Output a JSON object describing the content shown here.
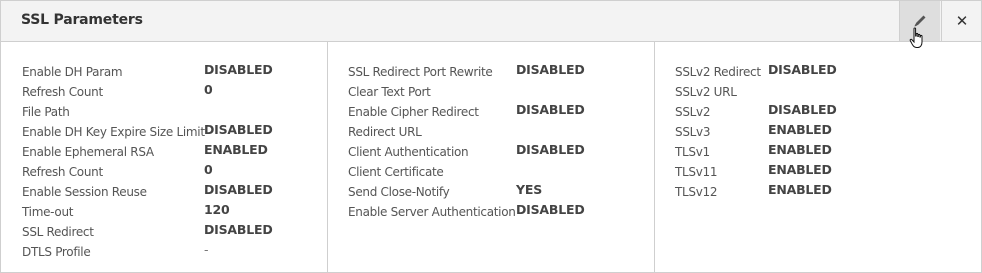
{
  "panel": {
    "title": "SSL Parameters",
    "edit_icon": "pencil-icon",
    "close_icon": "close-icon",
    "close_label": "✕"
  },
  "columns": [
    {
      "rows": [
        {
          "label": "Enable DH Param",
          "value": "DISABLED"
        },
        {
          "label": "Refresh Count",
          "value": "0"
        },
        {
          "label": "File Path",
          "value": ""
        },
        {
          "label": "Enable DH Key Expire Size Limit",
          "value": "DISABLED"
        },
        {
          "label": "Enable Ephemeral RSA",
          "value": "ENABLED"
        },
        {
          "label": "Refresh Count",
          "value": "0"
        },
        {
          "label": "Enable Session Reuse",
          "value": "DISABLED"
        },
        {
          "label": "Time-out",
          "value": "120"
        },
        {
          "label": "SSL Redirect",
          "value": "DISABLED"
        },
        {
          "label": "DTLS Profile",
          "value": "-"
        }
      ]
    },
    {
      "rows": [
        {
          "label": "SSL Redirect Port Rewrite",
          "value": "DISABLED"
        },
        {
          "label": "Clear Text Port",
          "value": ""
        },
        {
          "label": "Enable Cipher Redirect",
          "value": "DISABLED"
        },
        {
          "label": "Redirect URL",
          "value": ""
        },
        {
          "label": "Client Authentication",
          "value": "DISABLED"
        },
        {
          "label": "Client Certificate",
          "value": ""
        },
        {
          "label": "Send Close-Notify",
          "value": "YES"
        },
        {
          "label": "Enable Server Authentication",
          "value": "DISABLED"
        }
      ]
    },
    {
      "rows": [
        {
          "label": "SSLv2 Redirect",
          "value": "DISABLED"
        },
        {
          "label": "SSLv2 URL",
          "value": ""
        },
        {
          "label": "SSLv2",
          "value": "DISABLED"
        },
        {
          "label": "SSLv3",
          "value": "ENABLED"
        },
        {
          "label": "TLSv1",
          "value": "ENABLED"
        },
        {
          "label": "TLSv11",
          "value": "ENABLED"
        },
        {
          "label": "TLSv12",
          "value": "ENABLED"
        }
      ]
    }
  ]
}
